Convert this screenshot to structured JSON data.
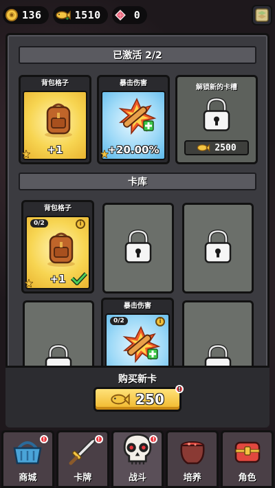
{
  "resources": {
    "coins": "136",
    "fish": "1510",
    "gems": "0"
  },
  "active_section": {
    "title": "已激活 2/2",
    "cards": [
      {
        "title": "背包格子",
        "value": "+1"
      },
      {
        "title": "暴击伤害",
        "value": "+20.00%"
      },
      {
        "title": "解锁新的卡槽",
        "price": "2500"
      }
    ]
  },
  "library_section": {
    "title": "卡库",
    "cards": [
      {
        "title": "背包格子",
        "count": "0/2",
        "value": "+1"
      },
      {
        "title": "暴击伤害",
        "count": "0/2"
      }
    ]
  },
  "buy": {
    "label": "购买新卡",
    "price": "250"
  },
  "nav": [
    {
      "label": "商城",
      "icon": "basket-icon"
    },
    {
      "label": "卡牌",
      "icon": "sword-icon"
    },
    {
      "label": "战斗",
      "icon": "skull-icon"
    },
    {
      "label": "培养",
      "icon": "cauldron-icon"
    },
    {
      "label": "角色",
      "icon": "chest-icon"
    }
  ]
}
